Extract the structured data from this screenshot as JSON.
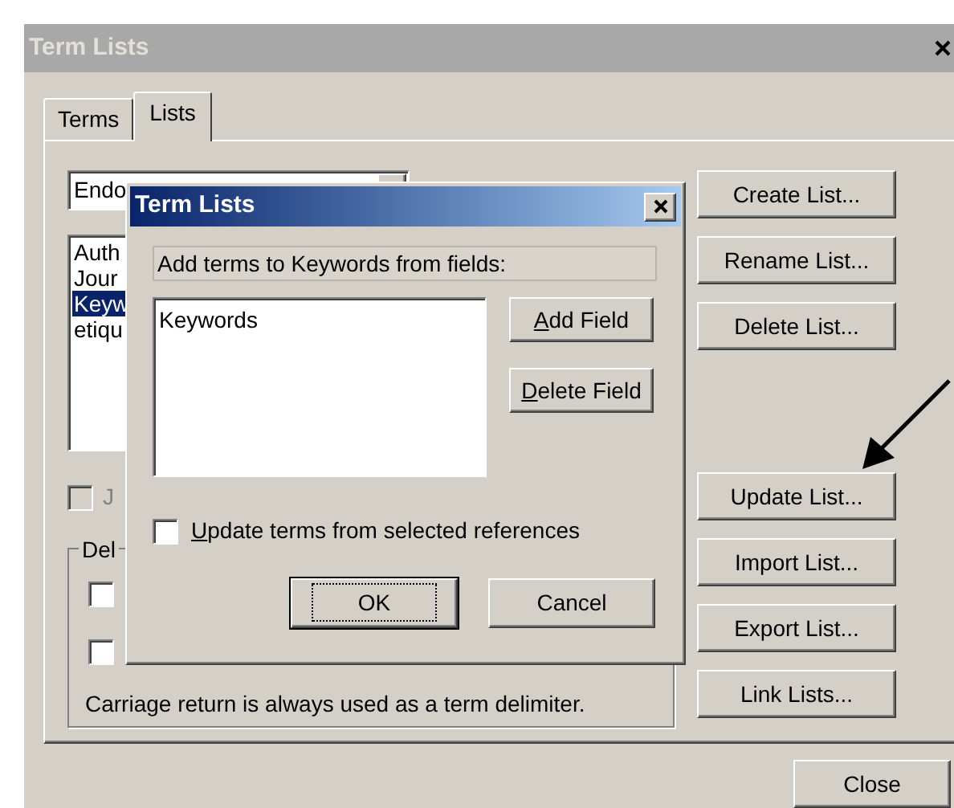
{
  "window": {
    "title": "Term Lists"
  },
  "tabs": [
    {
      "label": "Terms",
      "selected": false
    },
    {
      "label": "Lists",
      "selected": true
    }
  ],
  "list_combo": {
    "value": "Endo"
  },
  "lists": [
    {
      "label": "Auth",
      "selected": false
    },
    {
      "label": "Jour",
      "selected": false
    },
    {
      "label": "Keyw",
      "selected": true
    },
    {
      "label": "etiqu",
      "selected": false
    }
  ],
  "option_checkbox": {
    "label": "J",
    "checked": false,
    "disabled": true
  },
  "delimiter_group": {
    "title": "Del",
    "checkboxes": [
      {
        "checked": false
      },
      {
        "checked": false
      }
    ],
    "note": "Carriage return is always used as a term delimiter."
  },
  "list_buttons": [
    [
      "Create List...",
      "Rename List...",
      "Delete List..."
    ],
    [
      "Update List...",
      "Import List...",
      "Export List...",
      "Link Lists..."
    ]
  ],
  "close_button": "Close",
  "dialog": {
    "title": "Term Lists",
    "prompt": "Add terms to Keywords from fields:",
    "fields": [
      "Keywords"
    ],
    "field_buttons": [
      "Add Field",
      "Delete Field"
    ],
    "update_checkbox": {
      "label": "Update terms from selected references",
      "checked": false
    },
    "buttons": [
      {
        "label": "OK",
        "default": true
      },
      {
        "label": "Cancel",
        "default": false
      }
    ]
  }
}
